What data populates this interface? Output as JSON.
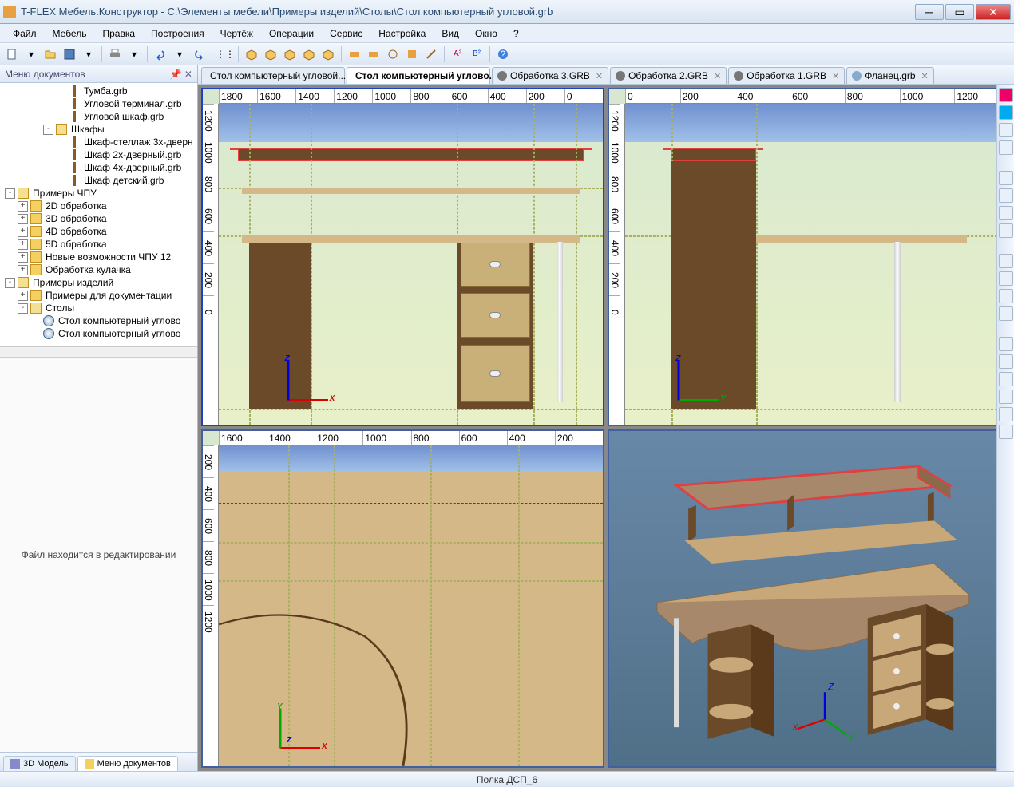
{
  "title": "T-FLEX Мебель.Конструктор - C:\\Элементы мебели\\Примеры изделий\\Столы\\Стол компьютерный угловой.grb",
  "menu": [
    "Файл",
    "Мебель",
    "Правка",
    "Построения",
    "Чертёж",
    "Операции",
    "Сервис",
    "Настройка",
    "Вид",
    "Окно",
    "?"
  ],
  "sidebar": {
    "title": "Меню документов",
    "items": [
      {
        "indent": 4,
        "icon": "panel",
        "label": "Тумба.grb"
      },
      {
        "indent": 4,
        "icon": "panel",
        "label": "Угловой терминал.grb"
      },
      {
        "indent": 4,
        "icon": "panel",
        "label": "Угловой шкаф.grb"
      },
      {
        "indent": 3,
        "expander": "-",
        "icon": "folder-open",
        "label": "Шкафы"
      },
      {
        "indent": 4,
        "icon": "panel",
        "label": "Шкаф-стеллаж 3х-дверн"
      },
      {
        "indent": 4,
        "icon": "panel",
        "label": "Шкаф 2х-дверный.grb"
      },
      {
        "indent": 4,
        "icon": "panel",
        "label": "Шкаф 4х-дверный.grb"
      },
      {
        "indent": 4,
        "icon": "panel",
        "label": "Шкаф детский.grb"
      },
      {
        "indent": 0,
        "expander": "-",
        "icon": "folder-open",
        "label": "Примеры ЧПУ"
      },
      {
        "indent": 1,
        "expander": "+",
        "icon": "folder",
        "label": "2D обработка"
      },
      {
        "indent": 1,
        "expander": "+",
        "icon": "folder",
        "label": "3D обработка"
      },
      {
        "indent": 1,
        "expander": "+",
        "icon": "folder",
        "label": "4D обработка"
      },
      {
        "indent": 1,
        "expander": "+",
        "icon": "folder",
        "label": "5D обработка"
      },
      {
        "indent": 1,
        "expander": "+",
        "icon": "folder",
        "label": "Новые возможности ЧПУ 12"
      },
      {
        "indent": 1,
        "expander": "+",
        "icon": "folder",
        "label": "Обработка кулачка"
      },
      {
        "indent": 0,
        "expander": "-",
        "icon": "folder-open",
        "label": "Примеры изделий"
      },
      {
        "indent": 1,
        "expander": "+",
        "icon": "folder",
        "label": "Примеры для документации"
      },
      {
        "indent": 1,
        "expander": "-",
        "icon": "folder-open",
        "label": "Столы"
      },
      {
        "indent": 2,
        "icon": "doc",
        "label": "Стол компьютерный углово"
      },
      {
        "indent": 2,
        "icon": "doc",
        "label": "Стол компьютерный углово"
      }
    ],
    "preview_text": "Файл находится в редактировании"
  },
  "bottomTabs": [
    {
      "label": "3D Модель",
      "active": false
    },
    {
      "label": "Меню документов",
      "active": true
    }
  ],
  "docTabs": [
    {
      "label": "Стол компьютерный угловой...",
      "icon": "doc",
      "active": false
    },
    {
      "label": "Стол компьютерный углово...",
      "icon": "doc",
      "active": true
    },
    {
      "label": "Обработка 3.GRB",
      "icon": "gear",
      "active": false
    },
    {
      "label": "Обработка 2.GRB",
      "icon": "gear",
      "active": false
    },
    {
      "label": "Обработка 1.GRB",
      "icon": "gear",
      "active": false
    },
    {
      "label": "Фланец.grb",
      "icon": "doc",
      "active": false
    }
  ],
  "rulers": {
    "view1_h": [
      "1800",
      "1600",
      "1400",
      "1200",
      "1000",
      "800",
      "600",
      "400",
      "200",
      "0"
    ],
    "view1_v": [
      "1200",
      "1000",
      "800",
      "600",
      "400",
      "200",
      "0"
    ],
    "view2_h": [
      "0",
      "200",
      "400",
      "600",
      "800",
      "1000",
      "1200"
    ],
    "view2_v": [
      "1200",
      "1000",
      "800",
      "600",
      "400",
      "200",
      "0"
    ],
    "view3_h": [
      "1600",
      "1400",
      "1200",
      "1000",
      "800",
      "600",
      "400",
      "200"
    ],
    "view3_v": [
      "200",
      "400",
      "600",
      "800",
      "1000",
      "1200"
    ]
  },
  "status": "Полка ДСП_6"
}
